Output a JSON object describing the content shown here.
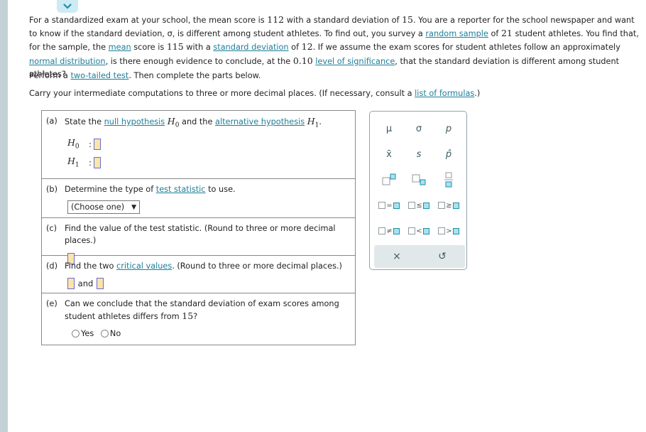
{
  "header": {
    "collapse_icon": "chevron-down-icon"
  },
  "intro": {
    "t1": "For a standardized exam at your school, the mean score is ",
    "n1": "112",
    "t2": " with a standard deviation of ",
    "n2": "15",
    "t3": ". You are a reporter for the school newspaper and want to know if the standard deviation, σ, is different among student athletes. To find out, you survey a ",
    "link_random_sample": "random sample",
    "t4": " of ",
    "n3": "21",
    "t5": " student athletes. You find that, for the sample, the ",
    "link_mean": "mean",
    "t6": " score is ",
    "n4": "115",
    "t7": " with a ",
    "link_std_dev": "standard deviation",
    "t8": " of ",
    "n5": "12",
    "t9": ". If we assume the exam scores for student athletes follow an approximately ",
    "link_normal": "normal distribution",
    "t10": ", is there enough evidence to conclude, at the ",
    "n6": "0.10",
    "t11": " ",
    "link_significance": "level of significance",
    "t12": ", that the standard deviation is different among student athletes?"
  },
  "instructions": {
    "perform_pre": "Perform a ",
    "perform_link": "two-tailed test",
    "perform_post": ". Then complete the parts below.",
    "carry_pre": "Carry your intermediate computations to three or more decimal places. (If necessary, consult a ",
    "carry_link": "list of formulas",
    "carry_post": ".)"
  },
  "parts": {
    "a": {
      "label": "(a)",
      "pre": "State the ",
      "link_null": "null hypothesis",
      "mid": " and the ",
      "link_alt": "alternative hypothesis",
      "post": ".",
      "h0": "H",
      "h0_sub": "0",
      "h1": "H",
      "h1_sub": "1",
      "colon": ":"
    },
    "b": {
      "label": "(b)",
      "pre": "Determine the type of ",
      "link": "test statistic",
      "post": " to use.",
      "select_value": "(Choose one)",
      "select_arrow": "▼"
    },
    "c": {
      "label": "(c)",
      "text": "Find the value of the test statistic. (Round to three or more decimal places.)"
    },
    "d": {
      "label": "(d)",
      "pre": "Find the two ",
      "link": "critical values",
      "post": ". (Round to three or more decimal places.)",
      "and": "and"
    },
    "e": {
      "label": "(e)",
      "text": "Can we conclude that the standard deviation of exam scores among student athletes differs from ",
      "num": "15",
      "q": "?",
      "options": [
        "Yes",
        "No"
      ]
    }
  },
  "palette": {
    "symbols": [
      "μ",
      "σ",
      "p",
      "x̄",
      "s",
      "p̂"
    ],
    "relations": [
      "=",
      "≤",
      "≥",
      "≠",
      "<",
      ">"
    ],
    "clear": "×",
    "undo": "↺"
  }
}
